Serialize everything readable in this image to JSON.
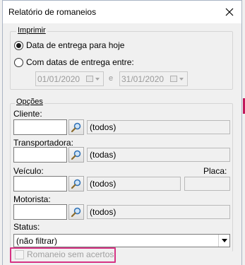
{
  "window": {
    "title": "Relatório de romaneios",
    "close_glyph": "✕"
  },
  "print_group": {
    "legend": "Imprimir",
    "option_today": "Data de entrega para hoje",
    "option_range": "Com datas de entrega entre:",
    "selected": "today",
    "date_from": "01/01/2020",
    "date_to": "31/01/2020",
    "separator": "e"
  },
  "options_group": {
    "legend": "Opções",
    "cliente": {
      "label": "Cliente:",
      "value": "",
      "display": "(todos)"
    },
    "transportadora": {
      "label": "Transportadora:",
      "value": "",
      "display": "(todas)"
    },
    "veiculo": {
      "label": "Veículo:",
      "value": "",
      "display": "(todos)"
    },
    "placa": {
      "label": "Placa:",
      "value": ""
    },
    "motorista": {
      "label": "Motorista:",
      "value": "",
      "display": "(todos)"
    },
    "status": {
      "label": "Status:",
      "selected": "(não filtrar)"
    },
    "romaneio_sem_acertos": {
      "label": "Romaneio sem acertos",
      "checked": false
    }
  },
  "icons": {
    "close": "close-icon",
    "search": "magnifier-icon",
    "calendar": "calendar-icon",
    "dropdown": "chevron-down-icon"
  },
  "colors": {
    "dialog_bg": "#f0f0f0",
    "highlight": "#d63384",
    "disabled_text": "#a0a0a0"
  }
}
